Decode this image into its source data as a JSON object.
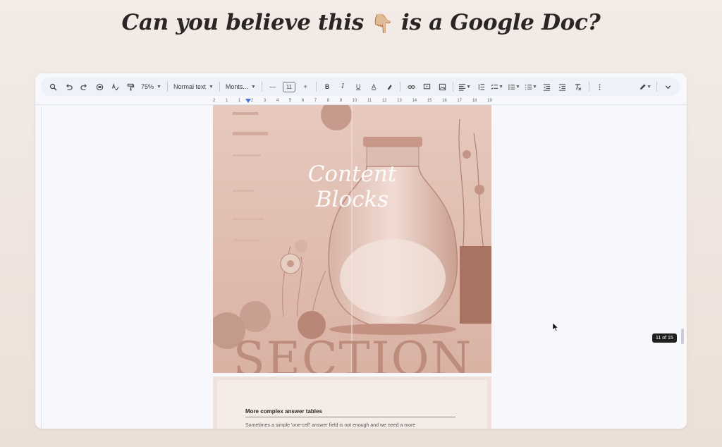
{
  "headline": {
    "before": "Can you believe this",
    "emoji": "👇🏼",
    "after": "is a Google Doc?"
  },
  "toolbar": {
    "zoom": "75%",
    "style": "Normal text",
    "font": "Monts...",
    "font_size": "11",
    "bold_label": "B",
    "italic_label": "I",
    "underline_label": "U",
    "text_color_label": "A"
  },
  "ruler": {
    "ticks": [
      "2",
      "1",
      "1",
      "2",
      "3",
      "4",
      "5",
      "6",
      "7",
      "8",
      "9",
      "10",
      "11",
      "12",
      "13",
      "14",
      "15",
      "16",
      "17",
      "18",
      "19"
    ]
  },
  "page1": {
    "title_line1": "Content",
    "title_line2": "Blocks",
    "section_word": "SECTION"
  },
  "page2": {
    "heading": "More complex answer tables",
    "body": "Sometimes a simple 'one-cell' answer field is not enough and we need a more"
  },
  "page_indicator": "11 of 15",
  "colors": {
    "accent": "#4a74d9",
    "page_tint": "#e4c4b8",
    "section_text": "#b37f6f"
  }
}
